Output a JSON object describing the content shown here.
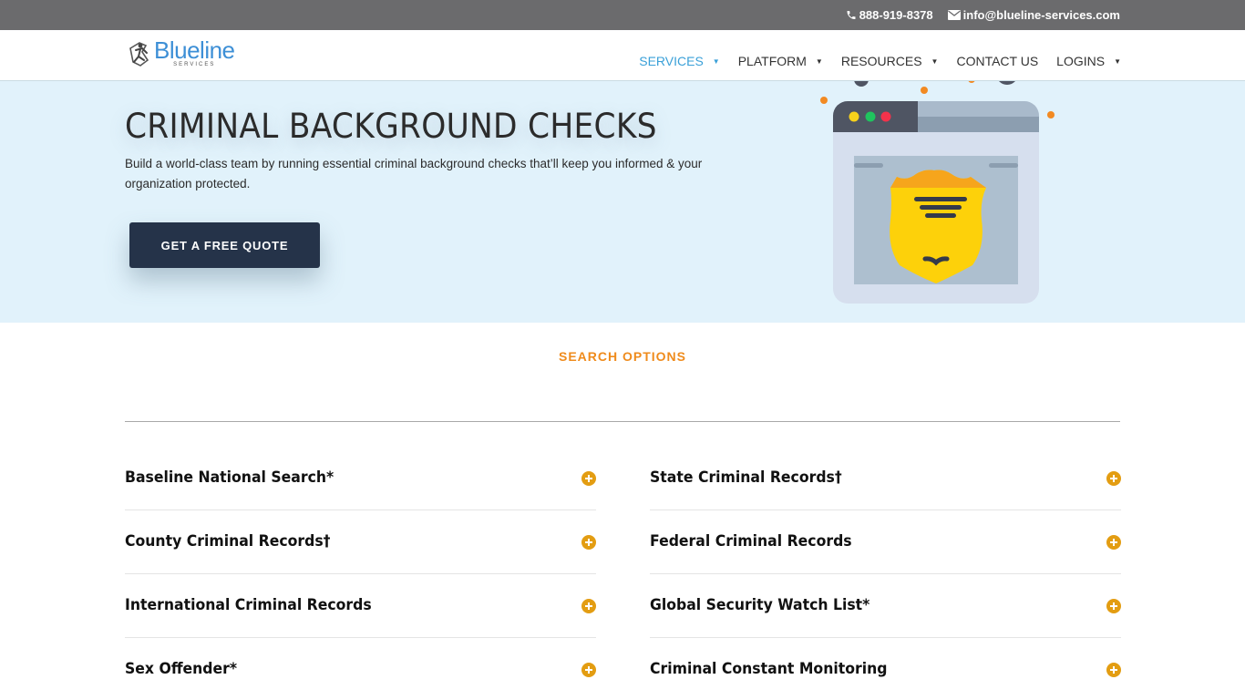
{
  "topbar": {
    "phone": "888-919-8378",
    "phone_icon": "phone-icon",
    "email": "info@blueline-services.com",
    "email_icon": "envelope-icon"
  },
  "header": {
    "logo": {
      "name": "Blueline",
      "sub": "SERVICES",
      "icon": "runner-logo-icon"
    },
    "nav": [
      {
        "label": "SERVICES",
        "dropdown": true,
        "active": true
      },
      {
        "label": "PLATFORM",
        "dropdown": true,
        "active": false
      },
      {
        "label": "RESOURCES",
        "dropdown": true,
        "active": false
      },
      {
        "label": "CONTACT US",
        "dropdown": false,
        "active": false
      },
      {
        "label": "LOGINS",
        "dropdown": true,
        "active": false
      }
    ],
    "caret": "▼"
  },
  "hero": {
    "title": "CRIMINAL BACKGROUND CHECKS",
    "description": "Build a world-class team by running essential criminal background checks that’ll keep you informed & your organization protected.",
    "cta_label": "GET A FREE QUOTE",
    "illustration": "browser-window-police-badge-illustration"
  },
  "search_options": {
    "label": "SEARCH OPTIONS",
    "left": [
      {
        "title": "Baseline National Search*"
      },
      {
        "title": "County Criminal Records†"
      },
      {
        "title": "International Criminal Records"
      },
      {
        "title": "Sex Offender*"
      }
    ],
    "right": [
      {
        "title": "State Criminal Records†"
      },
      {
        "title": "Federal Criminal Records"
      },
      {
        "title": "Global Security Watch List*"
      },
      {
        "title": "Criminal Constant Monitoring"
      }
    ],
    "toggle_icon": "plus-circle-icon"
  },
  "colors": {
    "topbar_bg": "#6b6b6d",
    "accent_blue": "#3aa0d8",
    "hero_bg": "#e1f2fb",
    "cta_bg": "#253349",
    "section_orange": "#ef8b1c",
    "toggle_gold": "#e39d12"
  }
}
